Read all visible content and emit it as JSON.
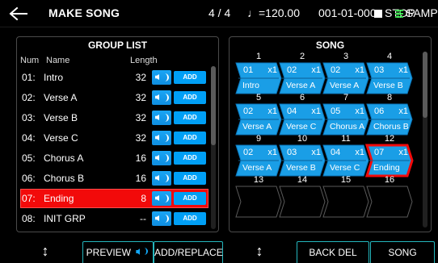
{
  "header": {
    "back_icon": "left-arrow-icon",
    "title": "MAKE SONG",
    "time_signature": "4 / 4",
    "tempo": "♩=120.00",
    "position": "001-01-000",
    "transport_status": "STOP",
    "mode": "SAMPLE PAD"
  },
  "group_panel": {
    "title": "GROUP LIST",
    "columns": {
      "num": "Num",
      "name": "Name",
      "length": "Length"
    },
    "add_label": "ADD",
    "rows": [
      {
        "num": "01:",
        "name": "Intro",
        "length": "32",
        "selected": false
      },
      {
        "num": "02:",
        "name": "Verse A",
        "length": "32",
        "selected": false
      },
      {
        "num": "03:",
        "name": "Verse B",
        "length": "32",
        "selected": false
      },
      {
        "num": "04:",
        "name": "Verse C",
        "length": "32",
        "selected": false
      },
      {
        "num": "05:",
        "name": "Chorus A",
        "length": "16",
        "selected": false
      },
      {
        "num": "06:",
        "name": "Chorus B",
        "length": "16",
        "selected": false
      },
      {
        "num": "07:",
        "name": "Ending",
        "length": "8",
        "selected": true
      },
      {
        "num": "08:",
        "name": "INIT GRP",
        "length": "--",
        "selected": false
      }
    ]
  },
  "song_panel": {
    "title": "SONG",
    "slots": [
      {
        "slot": "1",
        "group": "01",
        "repeat": "x1",
        "name": "Intro",
        "state": "filled"
      },
      {
        "slot": "2",
        "group": "02",
        "repeat": "x1",
        "name": "Verse A",
        "state": "filled"
      },
      {
        "slot": "3",
        "group": "02",
        "repeat": "x1",
        "name": "Verse A",
        "state": "filled"
      },
      {
        "slot": "4",
        "group": "03",
        "repeat": "x1",
        "name": "Verse B",
        "state": "filled"
      },
      {
        "slot": "5",
        "group": "02",
        "repeat": "x1",
        "name": "Verse A",
        "state": "filled"
      },
      {
        "slot": "6",
        "group": "04",
        "repeat": "x1",
        "name": "Verse C",
        "state": "filled"
      },
      {
        "slot": "7",
        "group": "05",
        "repeat": "x1",
        "name": "Chorus A",
        "state": "filled"
      },
      {
        "slot": "8",
        "group": "06",
        "repeat": "x1",
        "name": "Chorus B",
        "state": "filled"
      },
      {
        "slot": "9",
        "group": "02",
        "repeat": "x1",
        "name": "Verse A",
        "state": "filled"
      },
      {
        "slot": "10",
        "group": "03",
        "repeat": "x1",
        "name": "Verse B",
        "state": "filled"
      },
      {
        "slot": "11",
        "group": "04",
        "repeat": "x1",
        "name": "Verse C",
        "state": "filled"
      },
      {
        "slot": "12",
        "group": "07",
        "repeat": "x1",
        "name": "Ending",
        "state": "selected"
      },
      {
        "slot": "13",
        "group": "",
        "repeat": "",
        "name": "",
        "state": "empty"
      },
      {
        "slot": "14",
        "group": "",
        "repeat": "",
        "name": "",
        "state": "empty"
      },
      {
        "slot": "15",
        "group": "",
        "repeat": "",
        "name": "",
        "state": "empty"
      },
      {
        "slot": "16",
        "group": "",
        "repeat": "",
        "name": "",
        "state": "empty"
      }
    ]
  },
  "footer": {
    "left_move_icon": "up-down-arrow-icon",
    "preview": "PREVIEW",
    "preview_icon": "speaker-icon",
    "add_replace": "ADD/REPLACE",
    "right_move_icon": "up-down-arrow-icon",
    "back_del": "BACK DEL",
    "song": "SONG"
  },
  "colors": {
    "background": "#000000",
    "song_block": "#1a9ee6",
    "selected_red": "#f20a0a",
    "button_outline": "#24b6bd",
    "add_button": "#009ff5",
    "sample_pad": "#39d84a"
  }
}
